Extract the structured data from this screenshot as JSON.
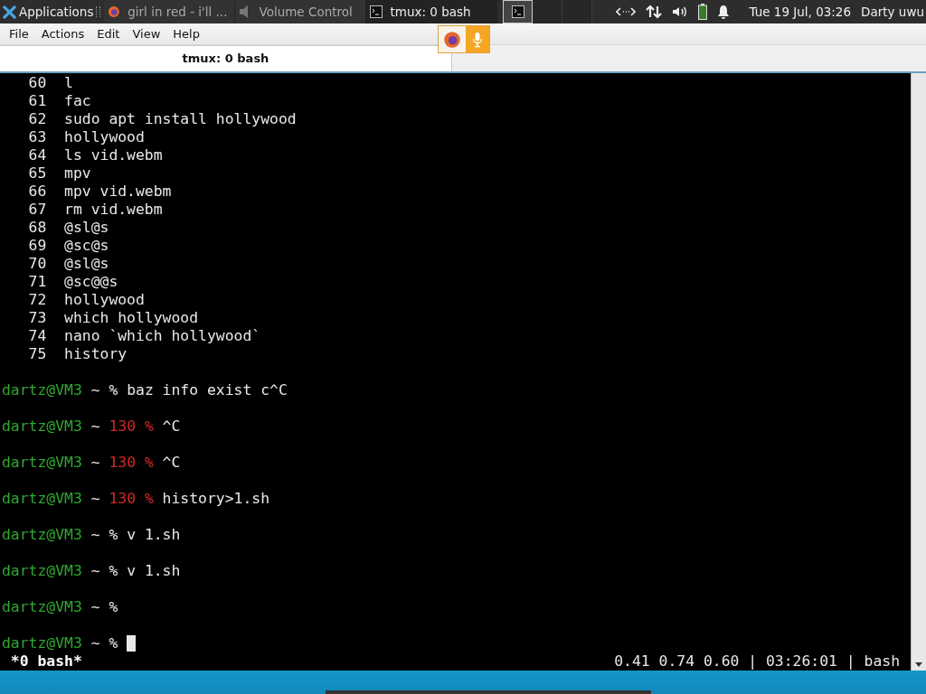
{
  "panel": {
    "apps_label": "Applications",
    "tasks": [
      {
        "label": "girl in red - i'll ...",
        "selected": false
      },
      {
        "label": "Volume Control",
        "selected": false
      },
      {
        "label": "tmux: 0 bash",
        "selected": true
      }
    ],
    "clock": "Tue 19 Jul, 03:26",
    "user": "Darty uwu"
  },
  "menu": [
    "File",
    "Actions",
    "Edit",
    "View",
    "Help"
  ],
  "tabs": [
    {
      "label": "tmux: 0 bash",
      "selected": true
    }
  ],
  "terminal": {
    "lines": [
      {
        "kind": "history",
        "num": "60",
        "cmd": "l"
      },
      {
        "kind": "history",
        "num": "61",
        "cmd": "fac"
      },
      {
        "kind": "history",
        "num": "62",
        "cmd": "sudo apt install hollywood"
      },
      {
        "kind": "history",
        "num": "63",
        "cmd": "hollywood"
      },
      {
        "kind": "history",
        "num": "64",
        "cmd": "ls vid.webm"
      },
      {
        "kind": "history",
        "num": "65",
        "cmd": "mpv"
      },
      {
        "kind": "history",
        "num": "66",
        "cmd": "mpv vid.webm"
      },
      {
        "kind": "history",
        "num": "67",
        "cmd": "rm vid.webm"
      },
      {
        "kind": "history",
        "num": "68",
        "cmd": "@sl@s"
      },
      {
        "kind": "history",
        "num": "69",
        "cmd": "@sc@s"
      },
      {
        "kind": "history",
        "num": "70",
        "cmd": "@sl@s"
      },
      {
        "kind": "history",
        "num": "71",
        "cmd": "@sc@@s"
      },
      {
        "kind": "history",
        "num": "72",
        "cmd": "hollywood"
      },
      {
        "kind": "history",
        "num": "73",
        "cmd": "which hollywood"
      },
      {
        "kind": "history",
        "num": "74",
        "cmd": "nano `which hollywood`"
      },
      {
        "kind": "history",
        "num": "75",
        "cmd": "history"
      },
      {
        "kind": "blank"
      },
      {
        "kind": "prompt",
        "user": "dartz@VM3",
        "path": "~",
        "mark": "%",
        "cmd": "baz info exist c^C"
      },
      {
        "kind": "blank"
      },
      {
        "kind": "prompt",
        "user": "dartz@VM3",
        "path": "~",
        "status": "130",
        "mark": "%",
        "cmd": "^C"
      },
      {
        "kind": "blank"
      },
      {
        "kind": "prompt",
        "user": "dartz@VM3",
        "path": "~",
        "status": "130",
        "mark": "%",
        "cmd": "^C"
      },
      {
        "kind": "blank"
      },
      {
        "kind": "prompt",
        "user": "dartz@VM3",
        "path": "~",
        "status": "130",
        "mark": "%",
        "cmd": "history>1.sh"
      },
      {
        "kind": "blank"
      },
      {
        "kind": "prompt",
        "user": "dartz@VM3",
        "path": "~",
        "mark": "%",
        "cmd": "v 1.sh"
      },
      {
        "kind": "blank"
      },
      {
        "kind": "prompt",
        "user": "dartz@VM3",
        "path": "~",
        "mark": "%",
        "cmd": "v 1.sh"
      },
      {
        "kind": "blank"
      },
      {
        "kind": "prompt",
        "user": "dartz@VM3",
        "path": "~",
        "mark": "%"
      },
      {
        "kind": "blank"
      },
      {
        "kind": "active_prompt",
        "user": "dartz@VM3",
        "path": "~",
        "mark": "%"
      }
    ],
    "status_left": "*0 bash*",
    "status_right": "0.41 0.74 0.60 | 03:26:01 | bash"
  }
}
